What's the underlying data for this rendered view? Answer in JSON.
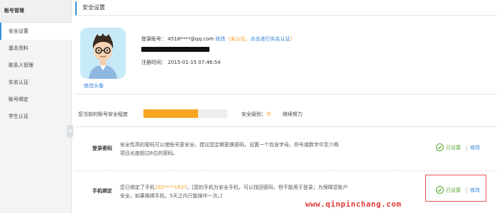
{
  "sidebar": {
    "header": "账号管理",
    "items": [
      {
        "label": "安全设置",
        "active": true
      },
      {
        "label": "基本资料",
        "active": false
      },
      {
        "label": "联系人管理",
        "active": false
      },
      {
        "label": "实名认证",
        "active": false
      },
      {
        "label": "账号绑定",
        "active": false
      },
      {
        "label": "学生认证",
        "active": false
      }
    ]
  },
  "main": {
    "title": "安全设置",
    "avatar_link": "修改头像",
    "account": {
      "label": "登录账号：",
      "value": "4518****@qq.com",
      "modify": "修改",
      "unverified": "(未认证，",
      "verify_link": "点击进行实名认证",
      "verify_close": ")"
    },
    "register": {
      "label": "注册时间：",
      "value": "2015-01-15 07:46:54"
    },
    "security": {
      "level_label": "您当前的账号安全程度",
      "progress": 0.65,
      "grade_label": "安全级别：",
      "grade_value": "中",
      "keep": "继续努力"
    },
    "rows": [
      {
        "title": "登录密码",
        "desc_line1": "安全性高的密码可以使账号更安全。建议您定期更换密码，设置一个包含字母，符号或数字中至少两",
        "desc_line2": "项且长度超过6位的密码。",
        "status": "已设置",
        "modify": "修改"
      },
      {
        "title": "手机绑定",
        "desc_prefix": "您已绑定了手机",
        "phone": "182****1637",
        "desc_line1_rest": "。[您的手机为安全手机，可以找回密码，但不能用于登录；为保障您账户",
        "desc_line2": "安全，如果换绑手机，5天之内只能操作一次。]",
        "status": "已设置",
        "modify": "修改"
      }
    ]
  },
  "watermark": "www.qinpinchang.com",
  "colors": {
    "accent": "#3a8fd4",
    "link": "#2f7ed8",
    "warning": "#f0a020",
    "success": "#5aa832",
    "highlight": "#e85555"
  }
}
